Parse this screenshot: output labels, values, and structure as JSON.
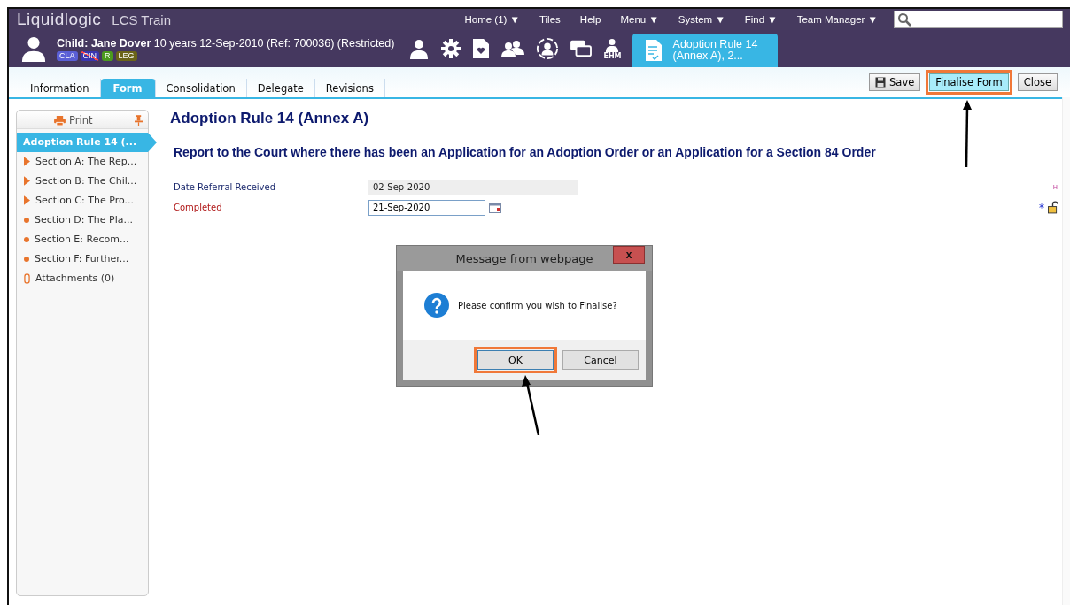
{
  "app": {
    "logo": "Liquidlogic",
    "product": "LCS Train"
  },
  "top_menu": [
    {
      "label": "Home (1) ▼"
    },
    {
      "label": "Tiles"
    },
    {
      "label": "Help"
    },
    {
      "label": "Menu ▼"
    },
    {
      "label": "System ▼"
    },
    {
      "label": "Find ▼"
    },
    {
      "label": "Team Manager ▼"
    }
  ],
  "person": {
    "name": "Child: Jane Dover",
    "details": "10 years 12-Sep-2010 (Ref: 700036) (Restricted)",
    "tags": [
      {
        "label": "CLA",
        "color": "#5a5fd6",
        "struck": false
      },
      {
        "label": "CIN",
        "color": "#3a36b0",
        "struck": true
      },
      {
        "label": "R",
        "color": "#4b9a1e",
        "struck": false
      },
      {
        "label": "LEG",
        "color": "#6b6418",
        "struck": false
      }
    ]
  },
  "toolbar_icons": [
    {
      "kind": "person"
    },
    {
      "kind": "gear"
    },
    {
      "kind": "document"
    },
    {
      "kind": "group"
    },
    {
      "kind": "network"
    },
    {
      "kind": "windows"
    },
    {
      "kind": "ehm",
      "label": "EHM"
    }
  ],
  "open_form_tab": {
    "title": "Adoption Rule 14 (Annex A), 2..."
  },
  "tabs": [
    {
      "label": "Information",
      "selected": false
    },
    {
      "label": "Form",
      "selected": true
    },
    {
      "label": "Consolidation",
      "selected": false
    },
    {
      "label": "Delegate",
      "selected": false
    },
    {
      "label": "Revisions",
      "selected": false
    }
  ],
  "actions": [
    {
      "label": "Save",
      "kind": "save",
      "highlighted": false
    },
    {
      "label": "Finalise Form",
      "kind": "primary",
      "highlighted": true
    },
    {
      "label": "Close",
      "kind": "plain",
      "highlighted": false
    }
  ],
  "sidebar": {
    "print": "Print",
    "items": [
      {
        "label": "Adoption Rule 14 (...",
        "kind": "current",
        "selected": true
      },
      {
        "label": "Section A: The Rep...",
        "kind": "arrow",
        "selected": false
      },
      {
        "label": "Section B: The Chil...",
        "kind": "arrow",
        "selected": false
      },
      {
        "label": "Section C: The Pro...",
        "kind": "arrow",
        "selected": false
      },
      {
        "label": "Section D: The Pla...",
        "kind": "dot",
        "selected": false
      },
      {
        "label": "Section E: Recom...",
        "kind": "dot",
        "selected": false
      },
      {
        "label": "Section F: Further...",
        "kind": "dot",
        "selected": false
      },
      {
        "label": "Attachments (0)",
        "kind": "attachment",
        "selected": false
      }
    ]
  },
  "form": {
    "title": "Adoption Rule 14 (Annex A)",
    "subtitle": "Report to the Court where there has been an Application for an Adoption Order or an Application for a Section 84 Order",
    "marker": "H",
    "fields": [
      {
        "label": "Date Referral Received",
        "value": "02-Sep-2020",
        "required": false,
        "editable": false
      },
      {
        "label": "Completed",
        "value": "21-Sep-2020",
        "required": true,
        "editable": true,
        "required_mark": "*"
      }
    ]
  },
  "dialog": {
    "title": "Message from webpage",
    "close": "x",
    "message": "Please confirm you wish to Finalise?",
    "buttons": [
      {
        "label": "OK",
        "highlighted": true
      },
      {
        "label": "Cancel",
        "highlighted": false
      }
    ]
  }
}
